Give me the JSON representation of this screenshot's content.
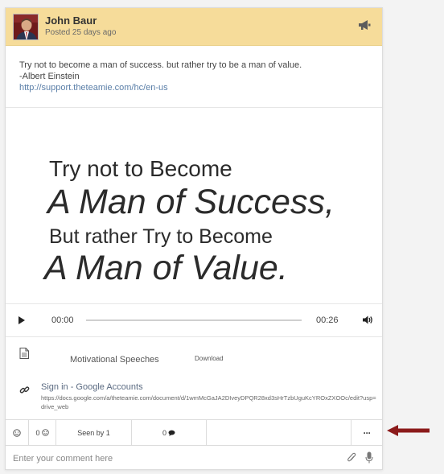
{
  "post": {
    "author": "John Baur",
    "posted": "Posted 25 days ago",
    "text_line1": "Try not to become a man of success. but rather try to be a man of value.",
    "text_line2": "-Albert Einstein",
    "link": "http://support.theteamie.com/hc/en-us",
    "header_icon": "megaphone-icon",
    "colors": {
      "header_bg": "#f6dc9a",
      "link": "#5b7fa8",
      "arrow": "#8b1a1a"
    }
  },
  "quote_image": {
    "line1": "Try not to Become",
    "line2": "A Man of Success,",
    "line3": "But rather Try to Become",
    "line4": "A Man of Value."
  },
  "audio": {
    "current_time": "00:00",
    "duration": "00:26",
    "progress": 0
  },
  "attachment": {
    "name": "Motivational Speeches",
    "download_label": "Download",
    "icon": "document-icon"
  },
  "link_preview": {
    "title": "Sign in - Google Accounts",
    "url": "https://docs.google.com/a/theteamie.com/document/d/1wmMcGaJA2DIveyDPQR28xd3sHrTzbUguKcYROxZXOOc/edit?usp=drive_web",
    "icon": "link-icon"
  },
  "actions": {
    "reactions_count": "0",
    "seen_by": "Seen by 1",
    "comments_count": "0",
    "more_label": "···"
  },
  "comment": {
    "placeholder": "Enter your comment here"
  }
}
